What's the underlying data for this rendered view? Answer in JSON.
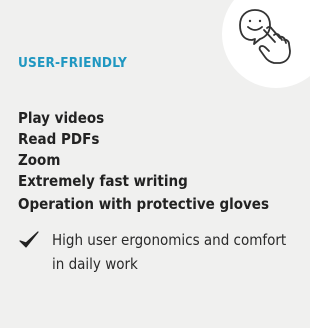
{
  "card": {
    "heading": "USER-FRIENDLY",
    "features": [
      "Play videos",
      "Read PDFs",
      "Zoom",
      "Extremely fast writing",
      "Operation with protective gloves"
    ],
    "benefit": "High user ergonomics and comfort in daily work",
    "icon": "touch-hand-smiley-icon",
    "check_icon": "checkmark-icon"
  },
  "colors": {
    "heading": "#1f97c1",
    "background": "#f0f0ef",
    "text": "#222222"
  }
}
